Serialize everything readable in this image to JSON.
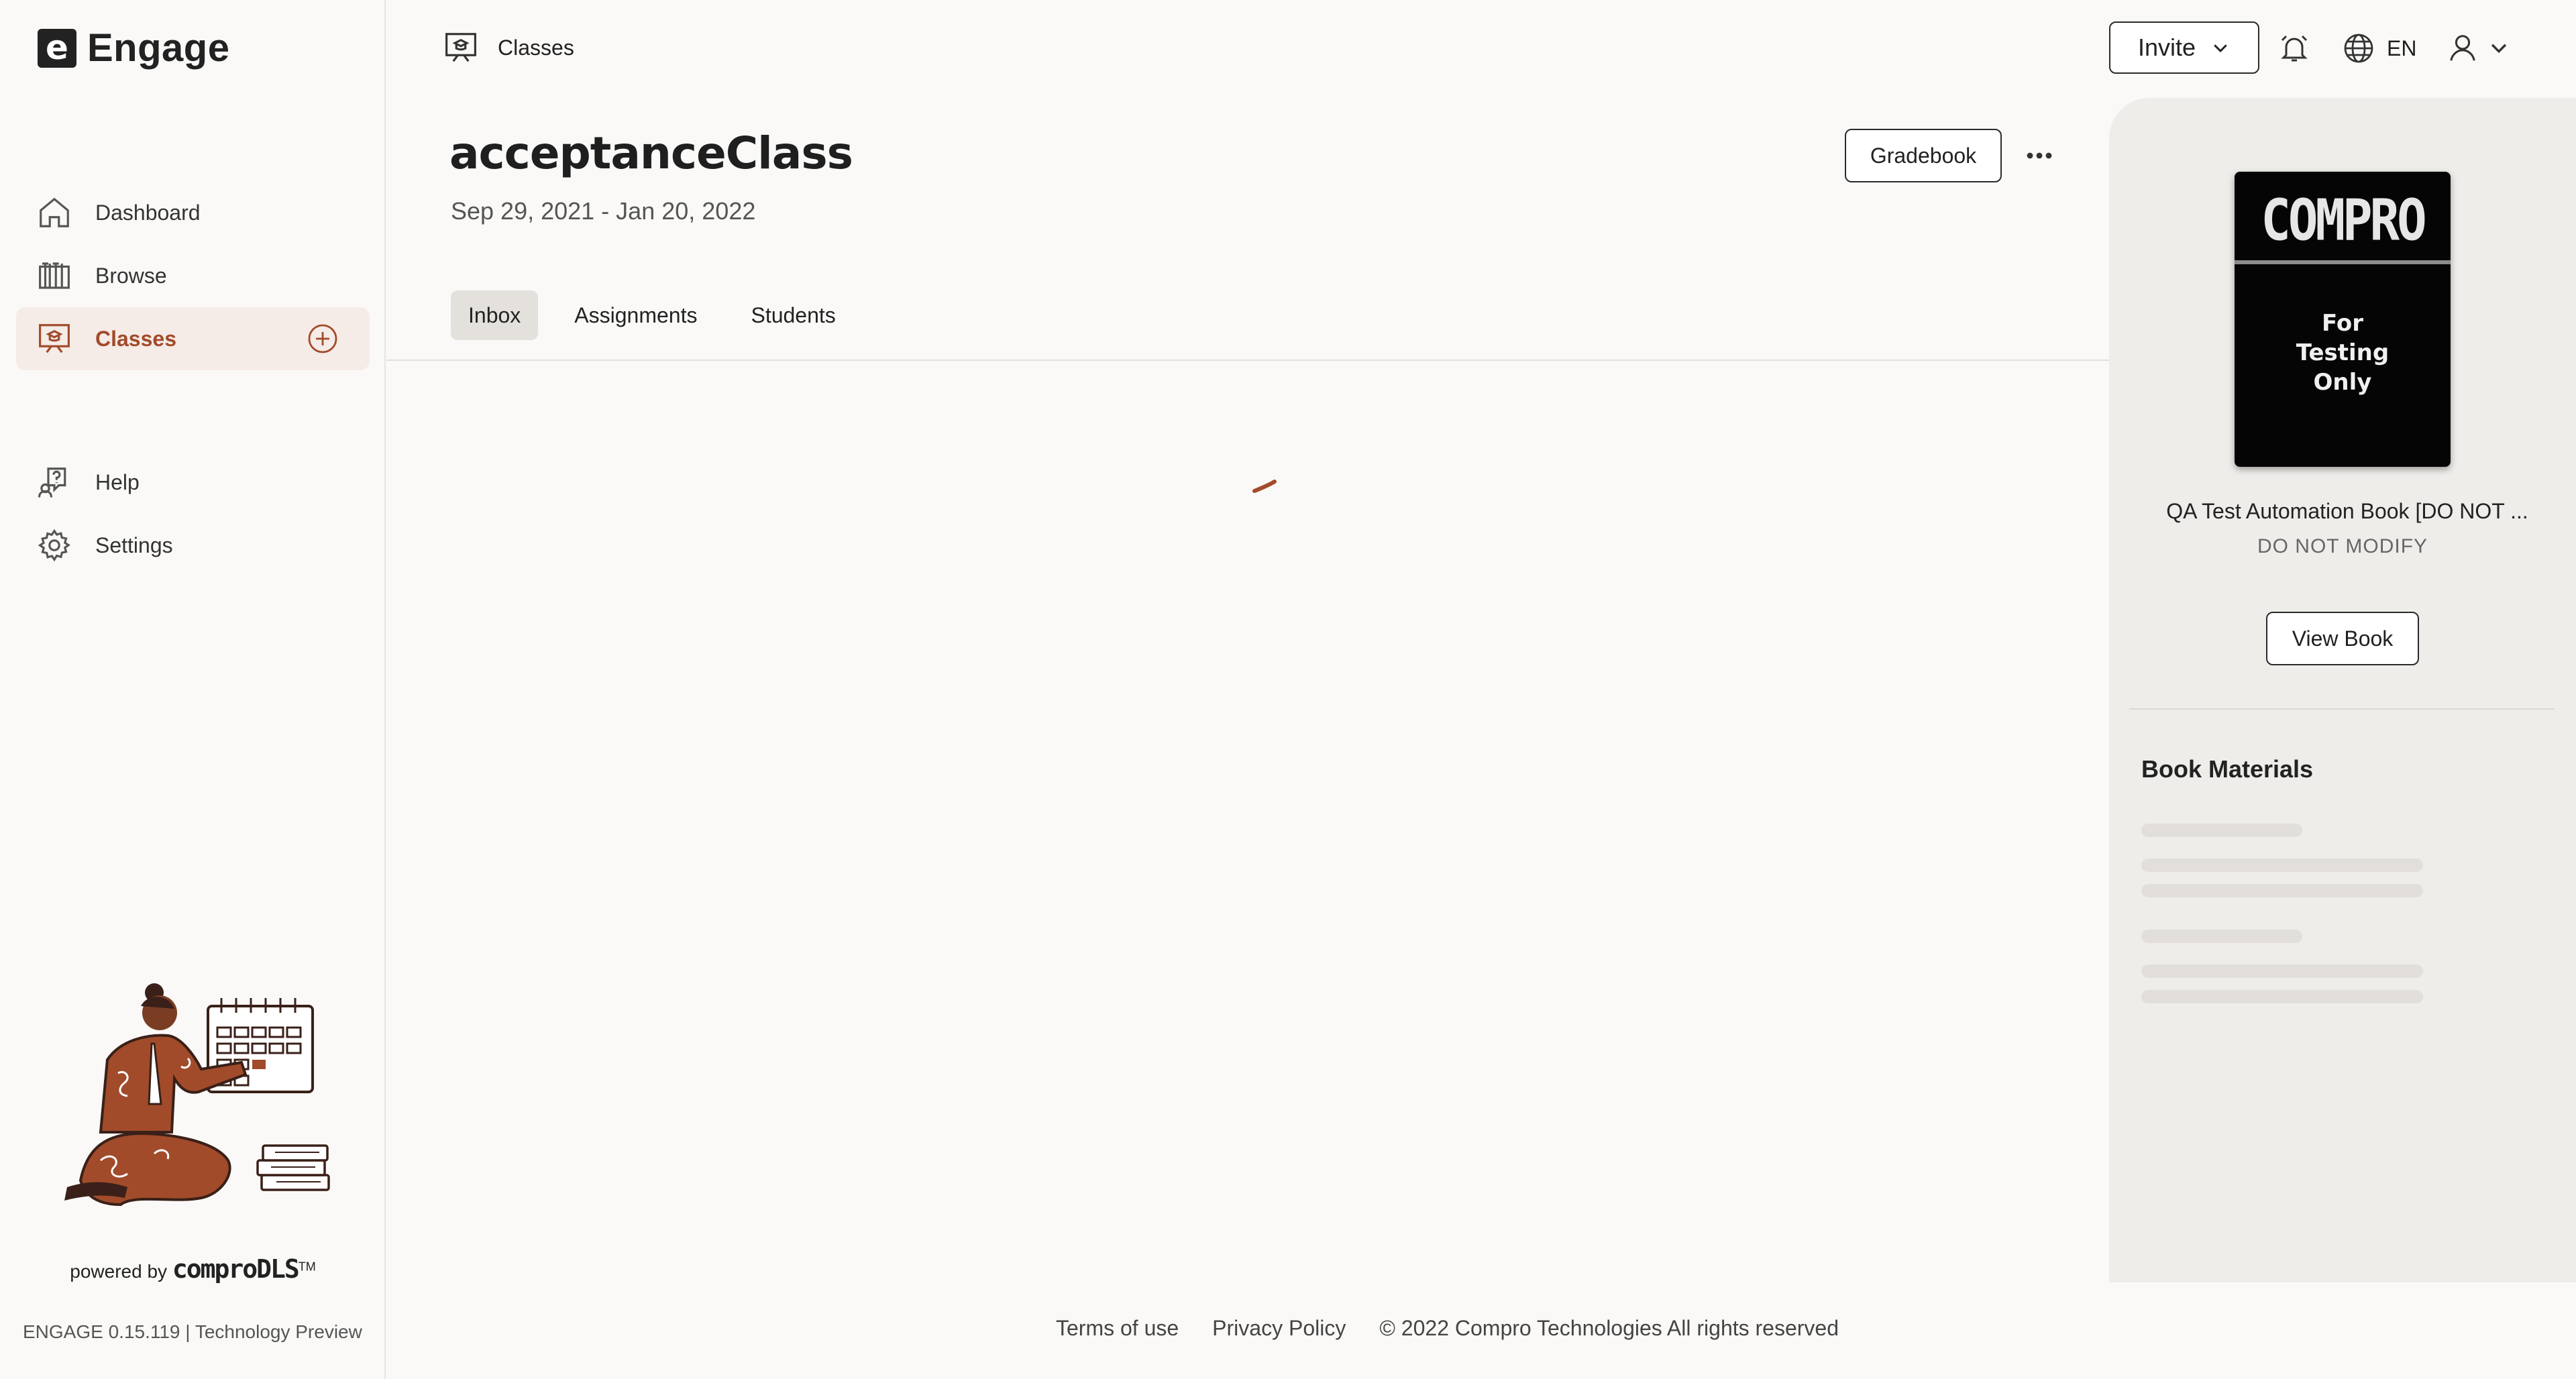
{
  "app": {
    "logo_letter": "e",
    "name": "Engage",
    "version_text": "ENGAGE 0.15.119 | Technology Preview",
    "powered_prefix": "powered by",
    "powered_brand": "comproDLS",
    "powered_tm": "TM"
  },
  "sidebar": {
    "items": [
      {
        "label": "Dashboard",
        "icon": "home-icon",
        "active": false
      },
      {
        "label": "Browse",
        "icon": "library-icon",
        "active": false
      },
      {
        "label": "Classes",
        "icon": "classroom-icon",
        "active": true
      },
      {
        "label": "Help",
        "icon": "help-icon",
        "active": false
      },
      {
        "label": "Settings",
        "icon": "gear-icon",
        "active": false
      }
    ]
  },
  "header": {
    "breadcrumb": "Classes",
    "invite_label": "Invite",
    "language": "EN"
  },
  "class": {
    "title": "acceptanceClass",
    "dates": "Sep 29, 2021 - Jan 20, 2022",
    "gradebook_label": "Gradebook",
    "tabs": [
      {
        "label": "Inbox",
        "active": true
      },
      {
        "label": "Assignments",
        "active": false
      },
      {
        "label": "Students",
        "active": false
      }
    ]
  },
  "book": {
    "cover_brand": "COMPRO",
    "cover_tag": "For\nTesting\nOnly",
    "title": "QA Test Automation Book [DO NOT ...",
    "subtitle": "DO NOT MODIFY",
    "view_label": "View Book",
    "materials_heading": "Book Materials"
  },
  "footer": {
    "terms": "Terms of use",
    "privacy": "Privacy Policy",
    "copyright": "© 2022 Compro Technologies All rights reserved"
  },
  "colors": {
    "accent": "#a14b2b",
    "active_bg": "#f5ebe7",
    "background": "#faf9f7",
    "panel_bg": "#efedea"
  }
}
